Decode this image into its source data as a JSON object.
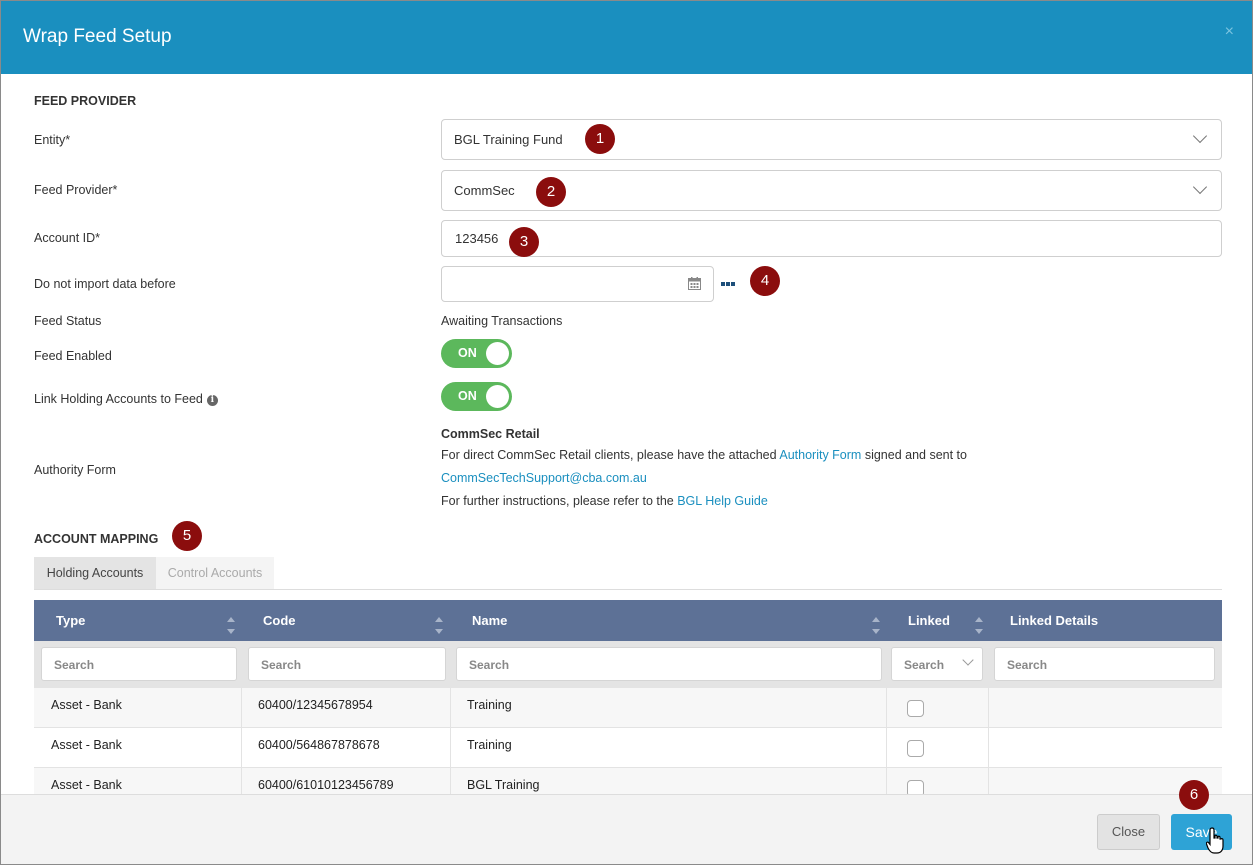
{
  "dialog": {
    "title": "Wrap Feed Setup",
    "close_glyph": "×"
  },
  "feed_provider": {
    "section_title": "FEED PROVIDER",
    "entity": {
      "label": "Entity*",
      "value": "BGL Training Fund"
    },
    "provider": {
      "label": "Feed Provider*",
      "value": "CommSec"
    },
    "account_id": {
      "label": "Account ID*",
      "value": "123456"
    },
    "import_before": {
      "label": "Do not import data before",
      "value": ""
    },
    "status": {
      "label": "Feed Status",
      "value": "Awaiting Transactions"
    },
    "enabled": {
      "label": "Feed Enabled",
      "state": "ON"
    },
    "link_holding": {
      "label": "Link Holding Accounts to Feed",
      "state": "ON",
      "info_glyph": "i"
    },
    "authority": {
      "label": "Authority Form",
      "heading": "CommSec Retail",
      "line1_pre": "For direct CommSec Retail clients, please have the attached ",
      "line1_link": "Authority Form",
      "line1_post": " signed and sent to",
      "email": "CommSecTechSupport@cba.com.au",
      "line3_pre": "For further instructions, please refer to the ",
      "line3_link": "BGL Help Guide"
    }
  },
  "markers": [
    "1",
    "2",
    "3",
    "4",
    "5",
    "6"
  ],
  "account_mapping": {
    "section_title": "ACCOUNT MAPPING",
    "tabs": [
      "Holding Accounts",
      "Control Accounts"
    ],
    "columns": [
      "Type",
      "Code",
      "Name",
      "Linked",
      "Linked Details"
    ],
    "filters": [
      "Search",
      "Search",
      "Search",
      "Search",
      "Search"
    ],
    "rows": [
      {
        "type": "Asset - Bank",
        "code": "60400/12345678954",
        "name": "Training"
      },
      {
        "type": "Asset - Bank",
        "code": "60400/564867878678",
        "name": "Training"
      },
      {
        "type": "Asset - Bank",
        "code": "60400/61010123456789",
        "name": "BGL Training"
      }
    ]
  },
  "footer": {
    "close_label": "Close",
    "save_label": "Save"
  },
  "colors": {
    "header": "#1a8fbf",
    "grid_header": "#5d7196",
    "toggle_on": "#5cb85c",
    "save": "#2ea3d6",
    "marker": "#8b0d0d"
  }
}
